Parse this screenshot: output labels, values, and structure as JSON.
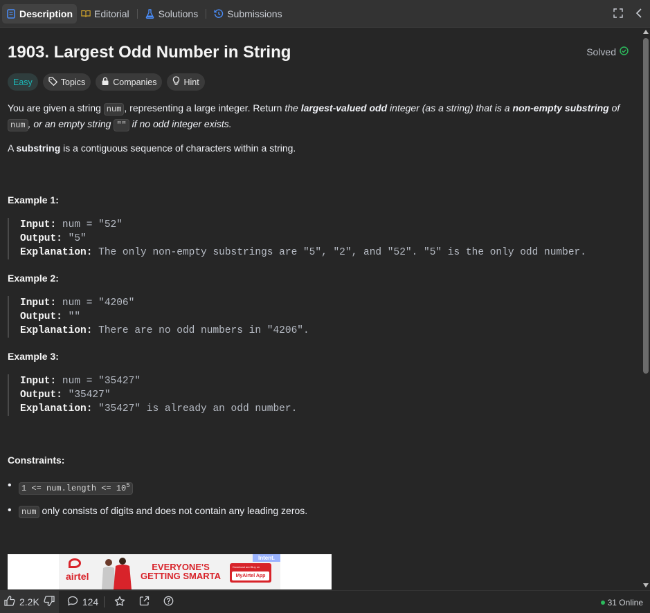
{
  "tabs": [
    {
      "label": "Description",
      "icon": "description-icon",
      "active": true
    },
    {
      "label": "Editorial",
      "icon": "book-icon",
      "active": false
    },
    {
      "label": "Solutions",
      "icon": "flask-icon",
      "active": false
    },
    {
      "label": "Submissions",
      "icon": "history-icon",
      "active": false
    }
  ],
  "problem": {
    "title": "1903. Largest Odd Number in String",
    "status": "Solved",
    "difficulty": "Easy",
    "chips": {
      "topics": "Topics",
      "companies": "Companies",
      "hint": "Hint"
    }
  },
  "description": {
    "p1_a": "You are given a string ",
    "p1_code1": "num",
    "p1_b": ", representing a large integer. Return ",
    "p1_c": "the ",
    "p1_d": "largest-valued odd",
    "p1_e": " integer (as a string) that is a ",
    "p1_f": "non-empty substring",
    "p1_g": " of ",
    "p1_code2": "num",
    "p1_h": ", or an empty string ",
    "p1_code3": "\"\"",
    "p1_i": " if no odd integer exists.",
    "p2_a": "A ",
    "p2_b": "substring",
    "p2_c": " is a contiguous sequence of characters within a string."
  },
  "examples": [
    {
      "heading": "Example 1:",
      "input": "num = \"52\"",
      "output": "\"5\"",
      "explanation": "The only non-empty substrings are \"5\", \"2\", and \"52\". \"5\" is the only odd number."
    },
    {
      "heading": "Example 2:",
      "input": "num = \"4206\"",
      "output": "\"\"",
      "explanation": "There are no odd numbers in \"4206\"."
    },
    {
      "heading": "Example 3:",
      "input": "num = \"35427\"",
      "output": "\"35427\"",
      "explanation": "\"35427\" is already an odd number."
    }
  ],
  "labels": {
    "input": "Input:",
    "output": "Output:",
    "explanation": "Explanation:"
  },
  "constraints": {
    "heading": "Constraints:",
    "c1_code": "1 <= num.length <= 10",
    "c1_sup": "5",
    "c2_code": "num",
    "c2_text": " only consists of digits and does not contain any leading zeros."
  },
  "ad": {
    "brand": "airtel",
    "headline_1": "EVERYONE'S",
    "headline_2": "GETTING SMARTA",
    "app_small": "Download and Buy on",
    "app_label": "MyAirtel App",
    "intent": "Intent."
  },
  "bottom": {
    "likes": "2.2K",
    "comments": "124",
    "online": "31 Online"
  },
  "colors": {
    "easy": "#1cb8b8",
    "solved": "#2cbb5d",
    "online": "#2cbb5d"
  }
}
